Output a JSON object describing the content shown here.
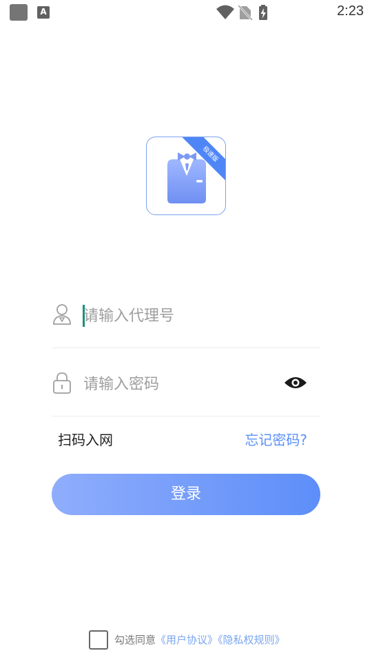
{
  "status_bar": {
    "time": "2:23",
    "badge_letter": "A"
  },
  "logo": {
    "ribbon": "极速版"
  },
  "form": {
    "account_placeholder": "请输入代理号",
    "password_placeholder": "请输入密码",
    "scan_label": "扫码入网",
    "forgot_label": "忘记密码?",
    "login_label": "登录"
  },
  "agreement": {
    "prefix": "勾选同意",
    "user_agreement": "《用户协议》",
    "privacy_rules": "《隐私权规则》"
  },
  "colors": {
    "accent": "#5b8ff9",
    "cursor": "#129379"
  }
}
